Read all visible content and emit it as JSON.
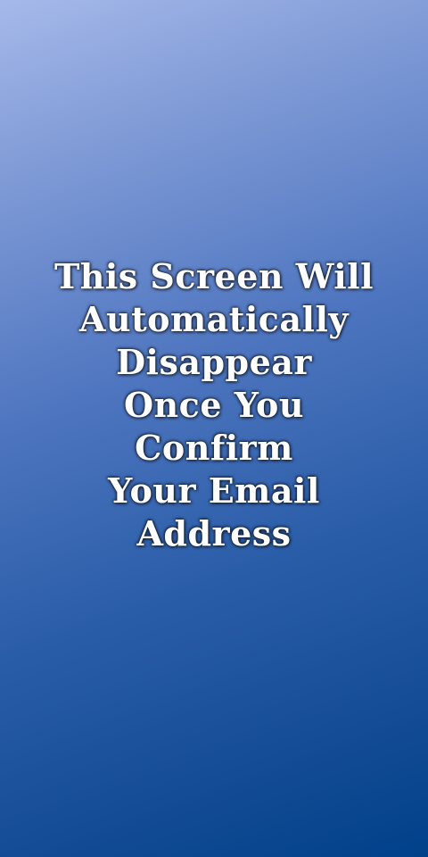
{
  "background": {
    "gradient_start": "#a6b9ea",
    "gradient_end": "#00418a"
  },
  "message": {
    "lines": [
      "This Screen Will",
      "Automatically",
      "Disappear",
      "Once You",
      "Confirm",
      "Your Email",
      "Address"
    ],
    "text_color": "#ffffff"
  }
}
